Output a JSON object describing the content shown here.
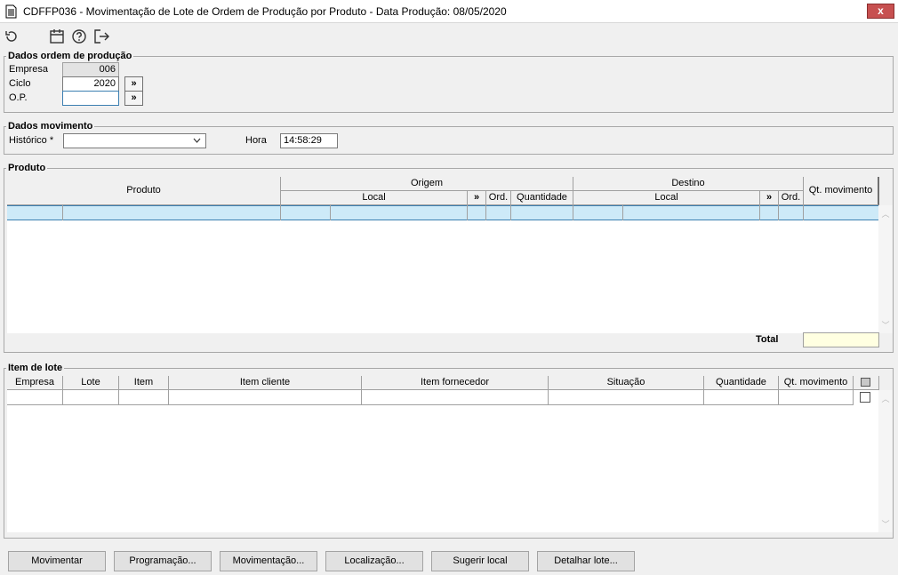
{
  "window": {
    "title": "CDFFP036 - Movimentação de Lote de Ordem de Produção por Produto - Data Produção: 08/05/2020",
    "close_label": "x"
  },
  "toolbar": {
    "icons": [
      "refresh-icon",
      "calendar-icon",
      "help-icon",
      "exit-icon"
    ]
  },
  "dados_ordem": {
    "legend": "Dados ordem de produção",
    "empresa_label": "Empresa",
    "empresa_value": "006",
    "ciclo_label": "Ciclo",
    "ciclo_value": "2020",
    "op_label": "O.P.",
    "op_value": "",
    "expand_label": "»"
  },
  "dados_movimento": {
    "legend": "Dados movimento",
    "historico_label": "Histórico *",
    "historico_value": "",
    "hora_label": "Hora",
    "hora_value": "14:58:29"
  },
  "produto": {
    "legend": "Produto",
    "headers": {
      "produto": "Produto",
      "origem": "Origem",
      "destino": "Destino",
      "local": "Local",
      "expand": "»",
      "ord": "Ord.",
      "quantidade": "Quantidade",
      "qt_movimento": "Qt. movimento"
    },
    "total_label": "Total",
    "total_value": ""
  },
  "item_lote": {
    "legend": "Item de lote",
    "headers": {
      "empresa": "Empresa",
      "lote": "Lote",
      "item": "Item",
      "item_cliente": "Item cliente",
      "item_fornecedor": "Item fornecedor",
      "situacao": "Situação",
      "quantidade": "Quantidade",
      "qt_movimento": "Qt. movimento"
    }
  },
  "buttons": {
    "movimentar": "Movimentar",
    "programacao": "Programação...",
    "movimentacao": "Movimentação...",
    "localizacao": "Localização...",
    "sugerir_local": "Sugerir local",
    "detalhar_lote": "Detalhar lote..."
  },
  "colors": {
    "selected_row": "#cdeaf8",
    "total_field": "#ffffe1"
  }
}
